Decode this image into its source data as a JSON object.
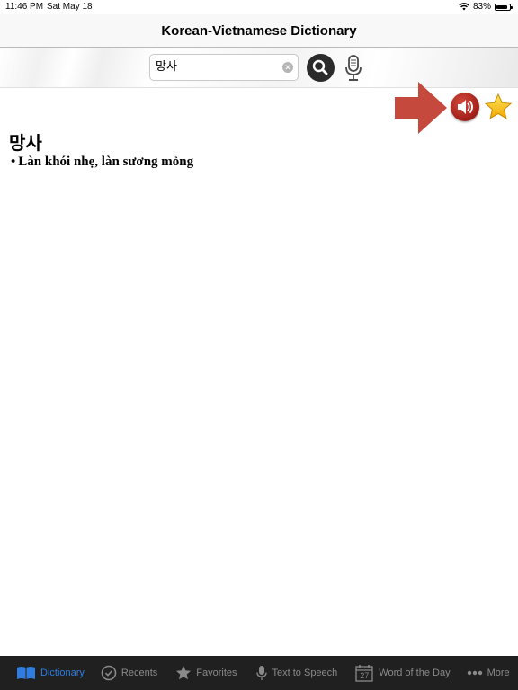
{
  "status_bar": {
    "time": "11:46 PM",
    "date": "Sat May 18",
    "battery_text": "83%",
    "battery_level": 0.83
  },
  "nav": {
    "title": "Korean-Vietnamese Dictionary"
  },
  "search": {
    "value": "망사"
  },
  "entry": {
    "word": "망사",
    "definitions": [
      "Làn khói nhẹ, làn sương mỏng"
    ]
  },
  "colors": {
    "accent": "#2f7de1",
    "tab_bar_bg": "#202020",
    "speaker": "#b0261d",
    "arrow": "#c0392b",
    "star": "#f5c518"
  },
  "icons": {
    "search": "search-icon",
    "clear": "clear-icon",
    "mic": "microphone-icon",
    "speaker": "speaker-icon",
    "favorite": "star-icon",
    "arrow": "arrow-right-icon"
  },
  "tabs": [
    {
      "label": "Dictionary",
      "icon": "book-icon",
      "active": true
    },
    {
      "label": "Recents",
      "icon": "checkmark-circle-icon",
      "active": false
    },
    {
      "label": "Favorites",
      "icon": "star-icon",
      "active": false
    },
    {
      "label": "Text to Speech",
      "icon": "microphone-icon",
      "active": false
    },
    {
      "label": "Word of the Day",
      "icon": "calendar-icon",
      "calendar_day": "27",
      "active": false
    },
    {
      "label": "More",
      "icon": "more-dots-icon",
      "active": false
    }
  ]
}
